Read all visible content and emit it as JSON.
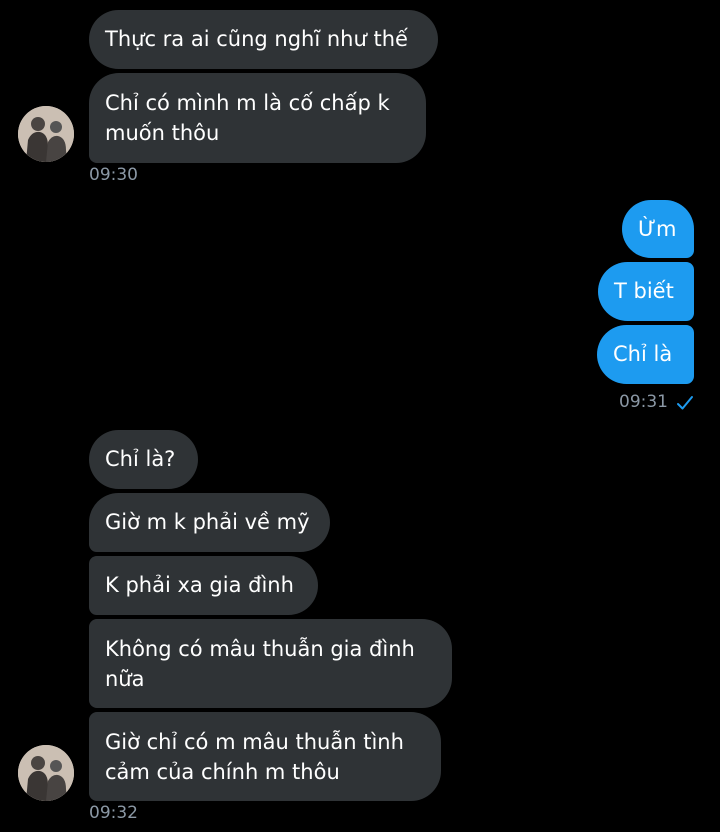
{
  "colors": {
    "background": "#000000",
    "incoming_bubble": "#2f3336",
    "outgoing_bubble": "#1d9bf0",
    "timestamp": "#8b98a5",
    "check": "#1d9bf0"
  },
  "group1": {
    "messages": [
      "Thực ra ai cũng nghĩ như thế",
      "Chỉ có mình m là cố chấp k",
      "muốn thôu"
    ],
    "time": "09:30"
  },
  "group2": {
    "messages": [
      "Ừm",
      "T biết",
      "Chỉ là"
    ],
    "time": "09:31",
    "status_icon": "check-icon"
  },
  "group3": {
    "messages": [
      "Chỉ là?",
      "Giờ m k phải về mỹ",
      "K phải xa gia đình",
      "Không có mâu thuẫn gia đình",
      "nữa",
      "Giờ chỉ có m mâu thuẫn tình",
      "cảm của chính m thôu"
    ],
    "time": "09:32"
  }
}
